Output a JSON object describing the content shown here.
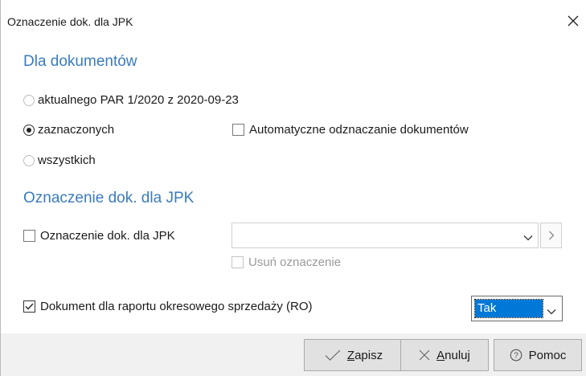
{
  "window": {
    "title": "Oznaczenie dok. dla JPK"
  },
  "section_documents": {
    "title": "Dla dokumentów",
    "radios": [
      {
        "label": "aktualnego PAR 1/2020 z 2020-09-23",
        "checked": false
      },
      {
        "label": "zaznaczonych",
        "checked": true
      },
      {
        "label": "wszystkich",
        "checked": false
      }
    ],
    "auto_unmark": {
      "label": "Automatyczne odznaczanie dokumentów",
      "checked": false
    }
  },
  "section_jpk": {
    "title": "Oznaczenie dok. dla JPK",
    "checkbox": {
      "label": "Oznaczenie dok. dla JPK",
      "checked": false
    },
    "combo_value": "",
    "remove_mark": {
      "label": "Usuń oznaczenie",
      "checked": false,
      "disabled": true
    }
  },
  "report": {
    "checkbox": {
      "label": "Dokument dla raportu okresowego sprzedaży (RO)",
      "checked": true
    },
    "select_value": "Tak"
  },
  "buttons": {
    "save": {
      "mnemonic": "Z",
      "rest": "apisz"
    },
    "cancel": {
      "mnemonic": "A",
      "rest": "nuluj"
    },
    "help": {
      "label": "Pomoc"
    }
  },
  "colors": {
    "section_title": "#3a7bbf",
    "selection": "#0078d7"
  }
}
